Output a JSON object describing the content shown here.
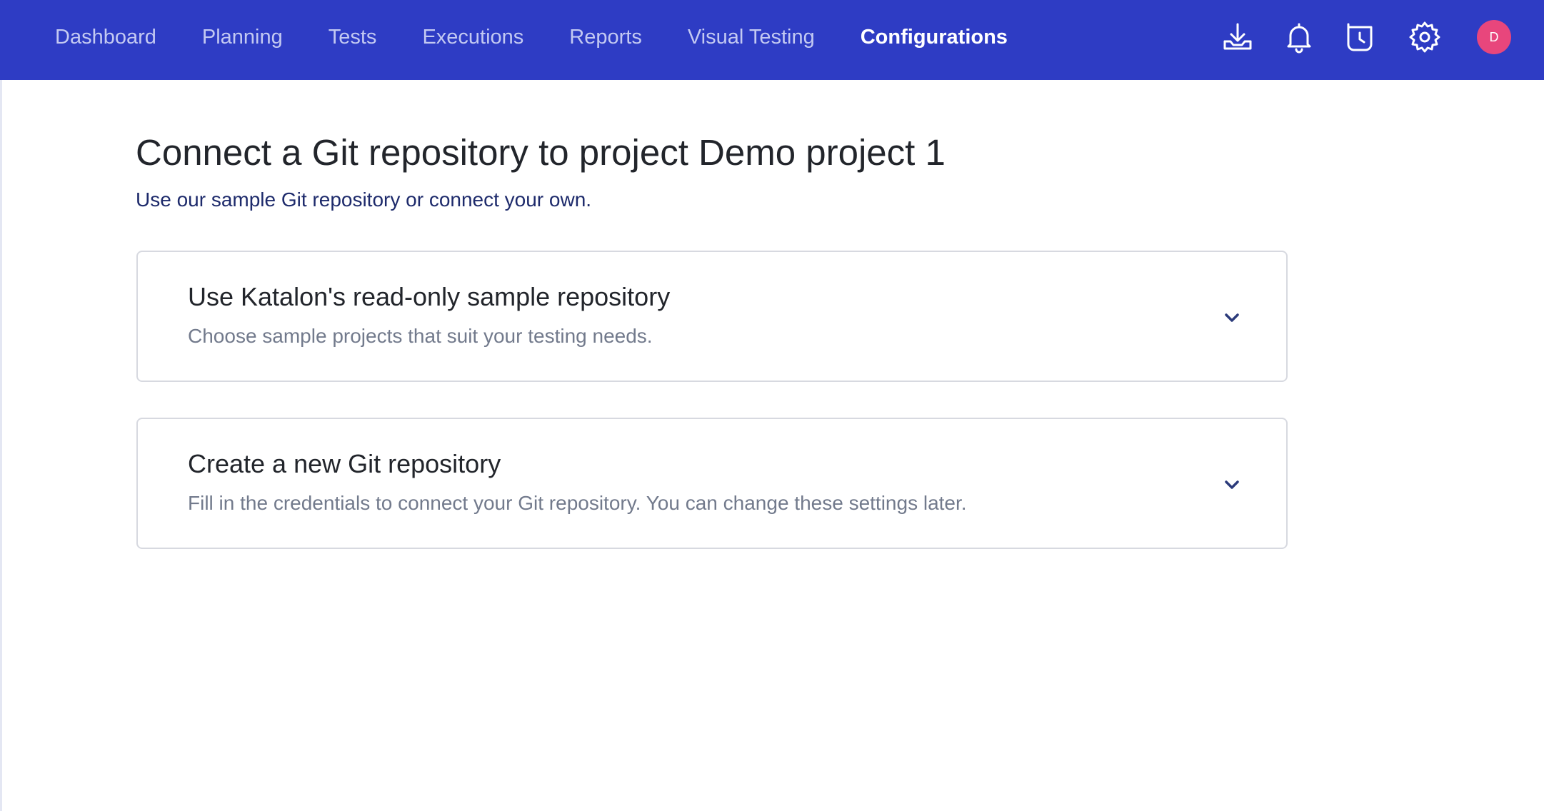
{
  "nav": {
    "items": [
      {
        "label": "Dashboard"
      },
      {
        "label": "Planning"
      },
      {
        "label": "Tests"
      },
      {
        "label": "Executions"
      },
      {
        "label": "Reports"
      },
      {
        "label": "Visual Testing"
      },
      {
        "label": "Configurations"
      }
    ],
    "active_index": 6,
    "icons": [
      "download-icon",
      "bell-icon",
      "history-icon",
      "gear-icon"
    ],
    "avatar_initial": "D"
  },
  "page": {
    "title": "Connect a Git repository to project Demo project 1",
    "subtitle": "Use our sample Git repository or connect your own."
  },
  "options": [
    {
      "title": "Use Katalon's read-only sample repository",
      "description": "Choose sample projects that suit your testing needs."
    },
    {
      "title": "Create a new Git repository",
      "description": "Fill in the credentials to connect your Git repository. You can change these settings later."
    }
  ],
  "colors": {
    "nav_background": "#2e3cc4",
    "nav_text": "#c3c9f2",
    "avatar": "#e8467c",
    "subtitle": "#1d2a6b",
    "muted_text": "#727a8c",
    "border": "#d7d9e0"
  }
}
